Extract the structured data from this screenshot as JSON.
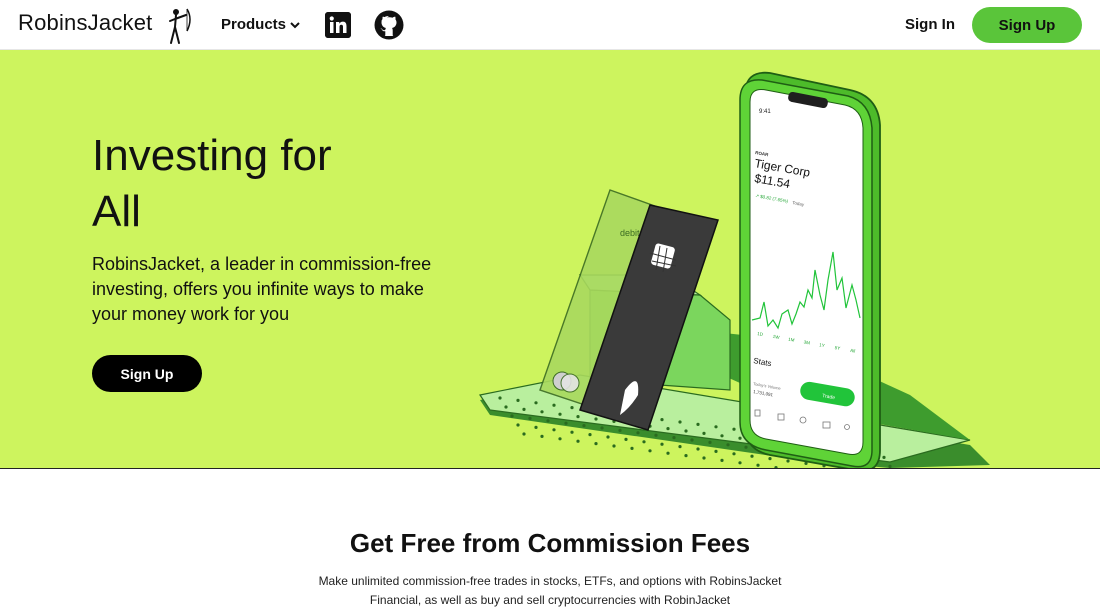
{
  "nav": {
    "logo": "RobinsJacket",
    "products_label": "Products",
    "signin_label": "Sign In",
    "signup_label": "Sign Up"
  },
  "hero": {
    "title": "Investing for All",
    "description": "RobinsJacket, a leader in commission-free investing, offers you infinite ways to make your money work for you",
    "cta_label": "Sign Up",
    "card_label": "debit",
    "phone": {
      "time": "9:41",
      "ticker": "ROAR",
      "company": "Tiger Corp",
      "price": "$11.54",
      "change": "↗ $0.82 (7.65%)",
      "change_period": "Today",
      "ranges": [
        "1D",
        "1W",
        "1M",
        "3M",
        "1Y",
        "5Y",
        "All"
      ],
      "stats_label": "Stats",
      "volume_label": "Today's Volume",
      "volume_value": "1,731,091",
      "trade_label": "Trade"
    }
  },
  "section": {
    "title": "Get Free from Commission Fees",
    "body": "Make unlimited commission-free trades in stocks, ETFs, and options with RobinsJacket Financial, as well as buy and sell cryptocurrencies with RobinJacket"
  },
  "colors": {
    "hero_bg": "#cdf45e",
    "brand_green": "#5ac53a",
    "dark": "#000000"
  },
  "icons": [
    "chevron-down-icon",
    "linkedin-icon",
    "github-icon",
    "archer-logo-icon",
    "feather-icon"
  ]
}
